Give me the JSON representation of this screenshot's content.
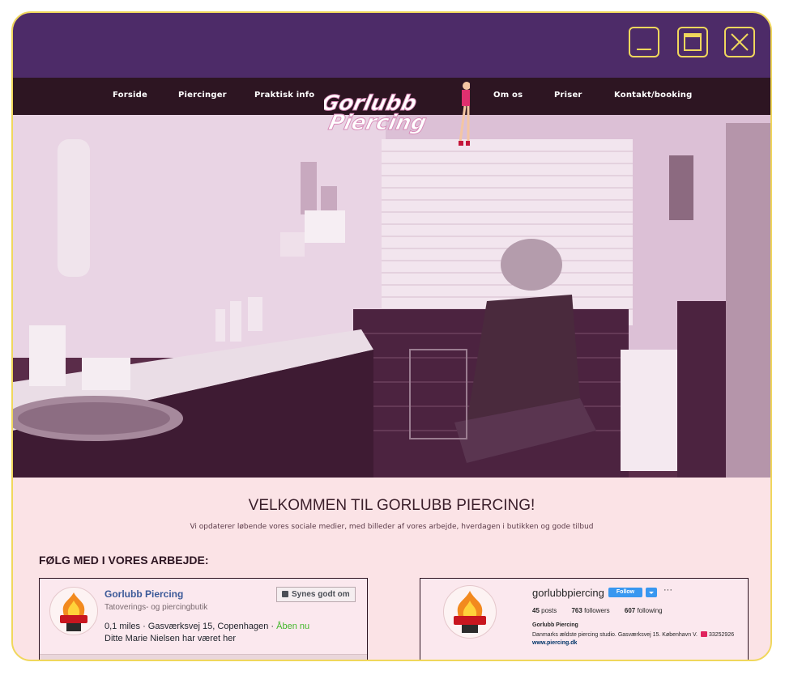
{
  "window": {
    "accent_color": "#4d2b68",
    "border_color": "#f0d75c",
    "controls": [
      "minimize-icon",
      "maximize-icon",
      "close-icon"
    ]
  },
  "nav": {
    "items": [
      "Forside",
      "Piercinger",
      "Praktisk info",
      "Om os",
      "Priser",
      "Kontakt/booking"
    ],
    "logo_text": [
      "Gorlubb",
      "Piercing"
    ]
  },
  "main": {
    "welcome": "VELKOMMEN TIL GORLUBB PIERCING!",
    "subtitle": "Vi opdaterer løbende vores sociale medier, med billeder af vores arbejde, hverdagen i butikken og gode tilbud",
    "follow_heading": "FØLG MED I VORES ARBEJDE:"
  },
  "facebook": {
    "name": "Gorlubb Piercing",
    "category": "Tatoverings- og piercingbutik",
    "like_label": "Synes godt om",
    "address": "0,1 miles · Gasværksvej 15, Copenhagen · ",
    "open_status": "Åben nu",
    "visited": "Ditte Marie Nielsen har været her"
  },
  "instagram": {
    "username": "gorlubbpiercing",
    "follow_label": "Follow",
    "more": "···",
    "posts": "45",
    "posts_label": " posts",
    "followers": "763",
    "followers_label": " followers",
    "following": "607",
    "following_label": " following",
    "display_name": "Gorlubb Piercing",
    "bio": "Danmarks ældste piercing studio. Gasværksvej 15. København V.",
    "phone": "33252926",
    "link": "www.piercing.dk"
  }
}
